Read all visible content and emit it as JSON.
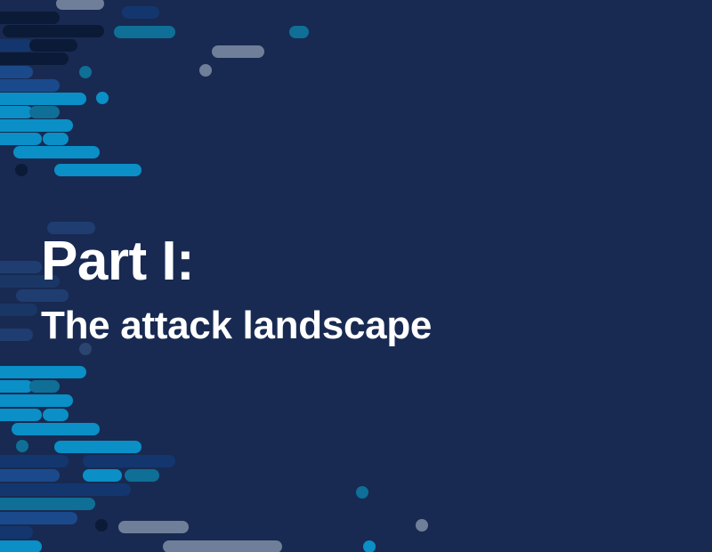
{
  "section": {
    "title": "Part I:",
    "subtitle": "The attack landscape"
  },
  "colors": {
    "background": "#182a52",
    "text": "#ffffff",
    "accent_bright": "#0a8fc7",
    "accent_teal": "#0f6f96",
    "accent_navy": "#14366e",
    "accent_dark": "#0b1a36",
    "accent_gray": "#6f7f99",
    "accent_deep_blue": "#1b4a8c"
  },
  "decoration": {
    "icon": "pill-stripes-pattern"
  }
}
